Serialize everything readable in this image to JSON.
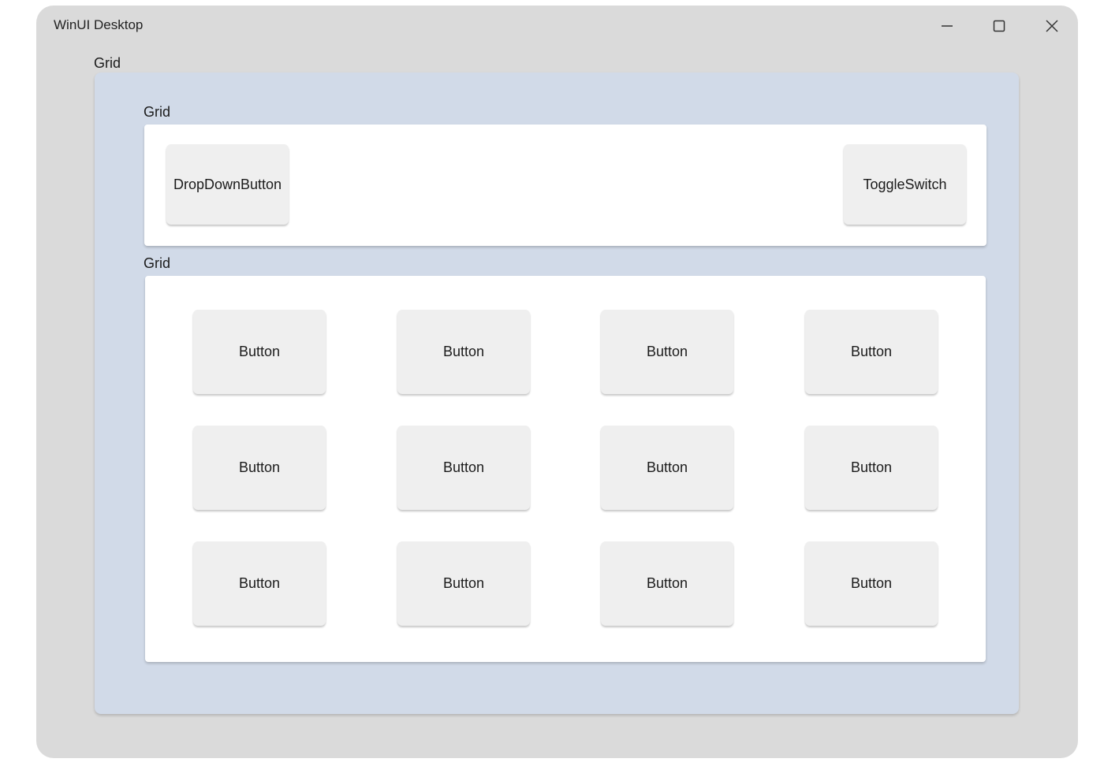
{
  "window": {
    "title": "WinUI Desktop"
  },
  "outer_grid": {
    "label": "Grid"
  },
  "top_grid": {
    "label": "Grid",
    "dropdown_label": "DropDownButton",
    "toggle_label": "ToggleSwitch"
  },
  "bottom_grid": {
    "label": "Grid",
    "buttons": [
      "Button",
      "Button",
      "Button",
      "Button",
      "Button",
      "Button",
      "Button",
      "Button",
      "Button",
      "Button",
      "Button",
      "Button"
    ]
  }
}
